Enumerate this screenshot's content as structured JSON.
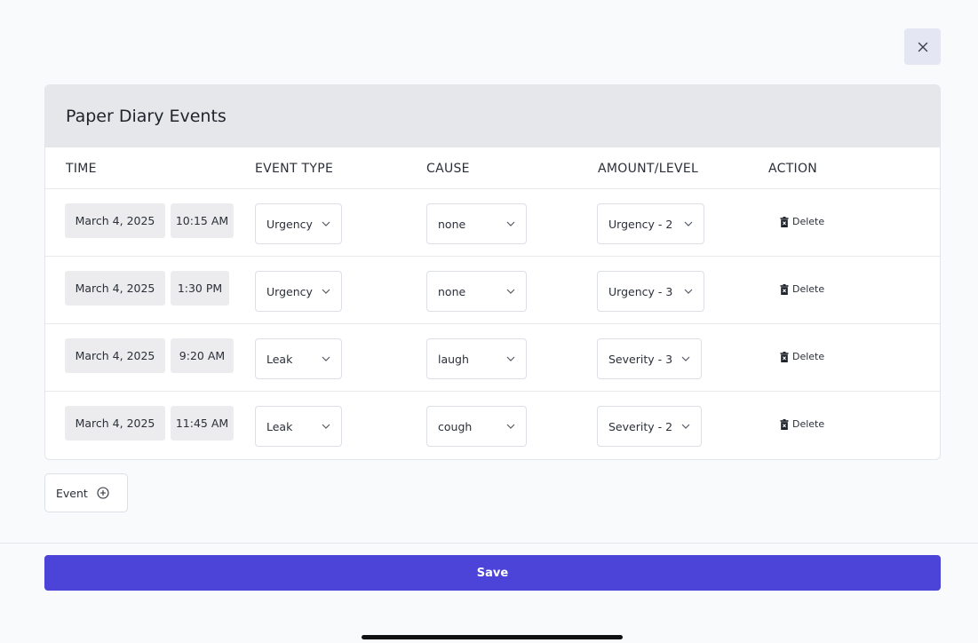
{
  "modal": {
    "title": "Paper Diary Events",
    "close_icon": "close-icon"
  },
  "table": {
    "headers": {
      "time": "TIME",
      "event_type": "EVENT TYPE",
      "cause": "CAUSE",
      "amount_level": "AMOUNT/LEVEL",
      "action": "ACTION"
    },
    "rows": [
      {
        "date": "March 4, 2025",
        "time": "10:15 AM",
        "event_type": "Urgency",
        "cause": "none",
        "level": "Urgency - 2",
        "action": "Delete"
      },
      {
        "date": "March 4, 2025",
        "time": "1:30 PM",
        "event_type": "Urgency",
        "cause": "none",
        "level": "Urgency - 3",
        "action": "Delete"
      },
      {
        "date": "March 4, 2025",
        "time": "9:20 AM",
        "event_type": "Leak",
        "cause": "laugh",
        "level": "Severity - 3",
        "action": "Delete"
      },
      {
        "date": "March 4, 2025",
        "time": "11:45 AM",
        "event_type": "Leak",
        "cause": "cough",
        "level": "Severity - 2",
        "action": "Delete"
      }
    ]
  },
  "add_event": {
    "label": "Event",
    "icon": "plus-circle-icon"
  },
  "footer": {
    "save_label": "Save"
  },
  "colors": {
    "accent": "#4c44d8",
    "header_bg": "#e5e7eb",
    "chip_bg": "#ececef",
    "close_bg": "#e4e6f3"
  }
}
